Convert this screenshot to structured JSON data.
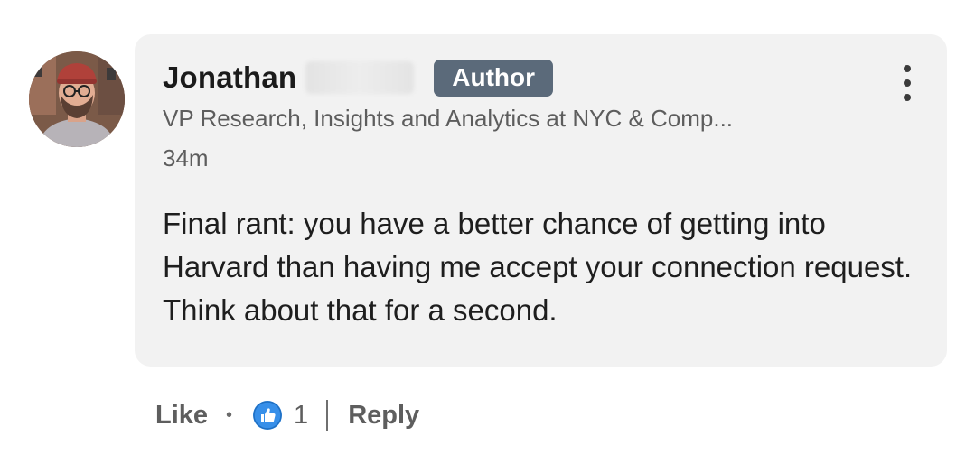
{
  "comment": {
    "author_name": "Jonathan",
    "author_badge": "Author",
    "headline": "VP Research, Insights and Analytics at NYC & Comp...",
    "timestamp": "34m",
    "text": "Final rant: you have a better chance of getting into Harvard than having me accept your connection request. Think about that for a second."
  },
  "actions": {
    "like_label": "Like",
    "separator": "•",
    "reaction_icon": "thumbs-up-icon",
    "reaction_count": "1",
    "reply_label": "Reply"
  },
  "menu": {
    "icon": "more-vertical-icon"
  },
  "colors": {
    "bubble_bg": "#f2f2f2",
    "badge_bg": "#5b6a7a",
    "reaction_blue": "#0a66c2"
  }
}
